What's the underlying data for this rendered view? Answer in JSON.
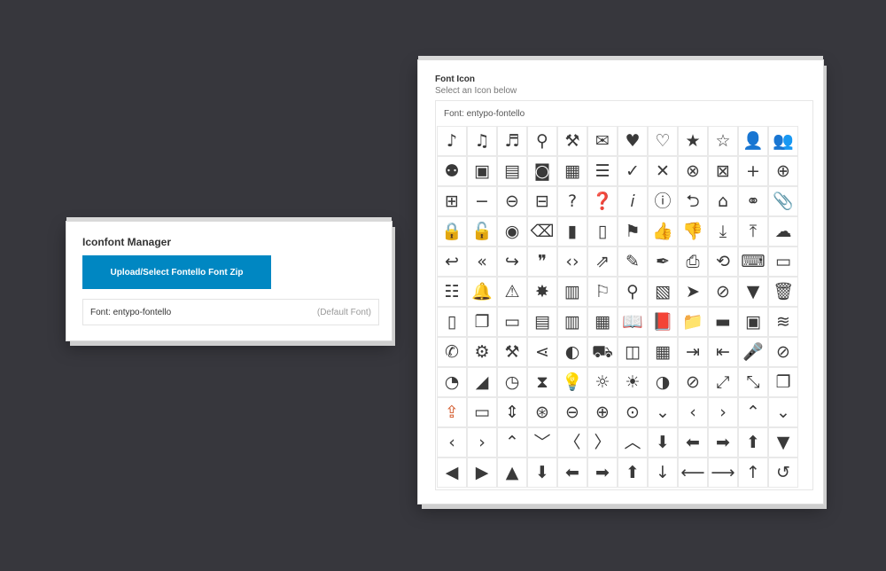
{
  "manager": {
    "title": "Iconfont Manager",
    "upload_label": "Upload/Select Fontello Font Zip",
    "font_name": "Font: entypo-fontello",
    "default_tag": "(Default Font)"
  },
  "icon_panel": {
    "title": "Font Icon",
    "subtitle": "Select an Icon below",
    "font_label": "Font: entypo-fontello",
    "selected_icon": "export-icon",
    "accent_color": "#d35a2c",
    "icons": [
      {
        "name": "music-note-icon",
        "glyph": "♪"
      },
      {
        "name": "music-notes-icon",
        "glyph": "♫"
      },
      {
        "name": "music-doc-icon",
        "glyph": "♬"
      },
      {
        "name": "search-icon",
        "glyph": "⚲"
      },
      {
        "name": "flashlight-icon",
        "glyph": "⚒"
      },
      {
        "name": "mail-icon",
        "glyph": "✉"
      },
      {
        "name": "heart-icon",
        "glyph": "♥"
      },
      {
        "name": "heart-empty-icon",
        "glyph": "♡"
      },
      {
        "name": "star-icon",
        "glyph": "★"
      },
      {
        "name": "star-empty-icon",
        "glyph": "☆"
      },
      {
        "name": "user-icon",
        "glyph": "👤"
      },
      {
        "name": "users-icon",
        "glyph": "👥"
      },
      {
        "name": "user-add-icon",
        "glyph": "⚉"
      },
      {
        "name": "video-icon",
        "glyph": "▣"
      },
      {
        "name": "picture-icon",
        "glyph": "▤"
      },
      {
        "name": "camera-icon",
        "glyph": "◙"
      },
      {
        "name": "layout-icon",
        "glyph": "▦"
      },
      {
        "name": "menu-icon",
        "glyph": "☰"
      },
      {
        "name": "check-icon",
        "glyph": "✓"
      },
      {
        "name": "cancel-icon",
        "glyph": "✕"
      },
      {
        "name": "cancel-circled-icon",
        "glyph": "⊗"
      },
      {
        "name": "cancel-squared-icon",
        "glyph": "⊠"
      },
      {
        "name": "plus-icon",
        "glyph": "+"
      },
      {
        "name": "plus-circled-icon",
        "glyph": "⊕"
      },
      {
        "name": "plus-squared-icon",
        "glyph": "⊞"
      },
      {
        "name": "minus-icon",
        "glyph": "−"
      },
      {
        "name": "minus-circled-icon",
        "glyph": "⊖"
      },
      {
        "name": "minus-squared-icon",
        "glyph": "⊟"
      },
      {
        "name": "help-icon",
        "glyph": "?"
      },
      {
        "name": "help-circled-icon",
        "glyph": "❓"
      },
      {
        "name": "info-icon",
        "glyph": "𝑖"
      },
      {
        "name": "info-circled-icon",
        "glyph": "ⓘ"
      },
      {
        "name": "back-icon",
        "glyph": "⮌"
      },
      {
        "name": "home-icon",
        "glyph": "⌂"
      },
      {
        "name": "link-icon",
        "glyph": "⚭"
      },
      {
        "name": "attach-icon",
        "glyph": "📎"
      },
      {
        "name": "lock-icon",
        "glyph": "🔒"
      },
      {
        "name": "lock-open-icon",
        "glyph": "🔓"
      },
      {
        "name": "eye-icon",
        "glyph": "◉"
      },
      {
        "name": "tag-icon",
        "glyph": "⌫"
      },
      {
        "name": "bookmark-icon",
        "glyph": "▮"
      },
      {
        "name": "bookmarks-icon",
        "glyph": "▯"
      },
      {
        "name": "flag-icon",
        "glyph": "⚑"
      },
      {
        "name": "thumbs-up-icon",
        "glyph": "👍"
      },
      {
        "name": "thumbs-down-icon",
        "glyph": "👎"
      },
      {
        "name": "download-icon",
        "glyph": "⤓"
      },
      {
        "name": "upload-icon",
        "glyph": "⤒"
      },
      {
        "name": "upload-cloud-icon",
        "glyph": "☁"
      },
      {
        "name": "reply-icon",
        "glyph": "↩"
      },
      {
        "name": "reply-all-icon",
        "glyph": "«"
      },
      {
        "name": "forward-icon",
        "glyph": "↪"
      },
      {
        "name": "quote-icon",
        "glyph": "❞"
      },
      {
        "name": "code-icon",
        "glyph": "‹›"
      },
      {
        "name": "export-share-icon",
        "glyph": "⇗"
      },
      {
        "name": "pencil-icon",
        "glyph": "✎"
      },
      {
        "name": "feather-icon",
        "glyph": "✒"
      },
      {
        "name": "print-icon",
        "glyph": "⎙"
      },
      {
        "name": "retweet-icon",
        "glyph": "⟲"
      },
      {
        "name": "keyboard-icon",
        "glyph": "⌨"
      },
      {
        "name": "comment-icon",
        "glyph": "▭"
      },
      {
        "name": "chat-icon",
        "glyph": "☷"
      },
      {
        "name": "bell-icon",
        "glyph": "🔔"
      },
      {
        "name": "attention-icon",
        "glyph": "⚠"
      },
      {
        "name": "alert-icon",
        "glyph": "✸"
      },
      {
        "name": "vcard-icon",
        "glyph": "▥"
      },
      {
        "name": "address-icon",
        "glyph": "⚐"
      },
      {
        "name": "location-icon",
        "glyph": "⚲"
      },
      {
        "name": "map-icon",
        "glyph": "▧"
      },
      {
        "name": "direction-icon",
        "glyph": "➤"
      },
      {
        "name": "compass-icon",
        "glyph": "⊘"
      },
      {
        "name": "cup-icon",
        "glyph": "▼"
      },
      {
        "name": "trash-icon",
        "glyph": "🗑"
      },
      {
        "name": "doc-icon",
        "glyph": "▯"
      },
      {
        "name": "docs-icon",
        "glyph": "❐"
      },
      {
        "name": "doc-landscape-icon",
        "glyph": "▭"
      },
      {
        "name": "doc-text-icon",
        "glyph": "▤"
      },
      {
        "name": "doc-text-inv-icon",
        "glyph": "▥"
      },
      {
        "name": "newspaper-icon",
        "glyph": "▦"
      },
      {
        "name": "book-open-icon",
        "glyph": "📖"
      },
      {
        "name": "book-icon",
        "glyph": "📕"
      },
      {
        "name": "folder-icon",
        "glyph": "📁"
      },
      {
        "name": "archive-icon",
        "glyph": "▬"
      },
      {
        "name": "box-icon",
        "glyph": "▣"
      },
      {
        "name": "rss-icon",
        "glyph": "≋"
      },
      {
        "name": "phone-icon",
        "glyph": "✆"
      },
      {
        "name": "cog-icon",
        "glyph": "⚙"
      },
      {
        "name": "tools-icon",
        "glyph": "⚒"
      },
      {
        "name": "share-icon",
        "glyph": "⋖"
      },
      {
        "name": "shareable-icon",
        "glyph": "◐"
      },
      {
        "name": "basket-icon",
        "glyph": "⛟"
      },
      {
        "name": "bag-icon",
        "glyph": "◫"
      },
      {
        "name": "calendar-icon",
        "glyph": "▦"
      },
      {
        "name": "login-icon",
        "glyph": "⇥"
      },
      {
        "name": "logout-icon",
        "glyph": "⇤"
      },
      {
        "name": "mic-icon",
        "glyph": "🎤"
      },
      {
        "name": "mute-icon",
        "glyph": "⊘"
      },
      {
        "name": "sound-icon",
        "glyph": "◔"
      },
      {
        "name": "volume-icon",
        "glyph": "◢"
      },
      {
        "name": "clock-icon",
        "glyph": "◷"
      },
      {
        "name": "hourglass-icon",
        "glyph": "⧗"
      },
      {
        "name": "lamp-icon",
        "glyph": "💡"
      },
      {
        "name": "light-down-icon",
        "glyph": "☼"
      },
      {
        "name": "light-up-icon",
        "glyph": "☀"
      },
      {
        "name": "adjust-icon",
        "glyph": "◑"
      },
      {
        "name": "block-icon",
        "glyph": "⊘"
      },
      {
        "name": "resize-full-icon",
        "glyph": "⤢"
      },
      {
        "name": "resize-small-icon",
        "glyph": "⤡"
      },
      {
        "name": "popup-icon",
        "glyph": "❐"
      },
      {
        "name": "export-icon",
        "glyph": "⇪"
      },
      {
        "name": "window-icon",
        "glyph": "▭"
      },
      {
        "name": "arrow-combo-icon",
        "glyph": "⇕"
      },
      {
        "name": "down-circled-icon",
        "glyph": "⊛"
      },
      {
        "name": "left-circled-icon",
        "glyph": "⊖"
      },
      {
        "name": "right-circled-icon",
        "glyph": "⊕"
      },
      {
        "name": "up-circled-icon",
        "glyph": "⊙"
      },
      {
        "name": "down-open-icon",
        "glyph": "⌄"
      },
      {
        "name": "left-open-icon",
        "glyph": "‹"
      },
      {
        "name": "right-open-icon",
        "glyph": "›"
      },
      {
        "name": "up-open-icon",
        "glyph": "⌃"
      },
      {
        "name": "down-open-mini-icon",
        "glyph": "⌄"
      },
      {
        "name": "left-open-mini-icon",
        "glyph": "‹"
      },
      {
        "name": "right-open-mini-icon",
        "glyph": "›"
      },
      {
        "name": "up-open-mini-icon",
        "glyph": "⌃"
      },
      {
        "name": "down-open-big-icon",
        "glyph": "﹀"
      },
      {
        "name": "left-open-big-icon",
        "glyph": "〈"
      },
      {
        "name": "right-open-big-icon",
        "glyph": "〉"
      },
      {
        "name": "up-open-big-icon",
        "glyph": "︿"
      },
      {
        "name": "down-bold-icon",
        "glyph": "⬇"
      },
      {
        "name": "left-bold-icon",
        "glyph": "⬅"
      },
      {
        "name": "right-bold-icon",
        "glyph": "➡"
      },
      {
        "name": "up-bold-icon",
        "glyph": "⬆"
      },
      {
        "name": "down-dir-icon",
        "glyph": "▼"
      },
      {
        "name": "left-dir-icon",
        "glyph": "◀"
      },
      {
        "name": "right-dir-icon",
        "glyph": "▶"
      },
      {
        "name": "up-dir-icon",
        "glyph": "▲"
      },
      {
        "name": "down-thin-bold-icon",
        "glyph": "⬇"
      },
      {
        "name": "left-thin-bold-icon",
        "glyph": "⬅"
      },
      {
        "name": "right-thin-bold-icon",
        "glyph": "➡"
      },
      {
        "name": "up-thin-bold-icon",
        "glyph": "⬆"
      },
      {
        "name": "down-thin-icon",
        "glyph": "↓"
      },
      {
        "name": "left-thin-icon",
        "glyph": "⟵"
      },
      {
        "name": "right-thin-icon",
        "glyph": "⟶"
      },
      {
        "name": "up-thin-icon",
        "glyph": "↑"
      },
      {
        "name": "ccw-icon",
        "glyph": "↺"
      }
    ]
  }
}
